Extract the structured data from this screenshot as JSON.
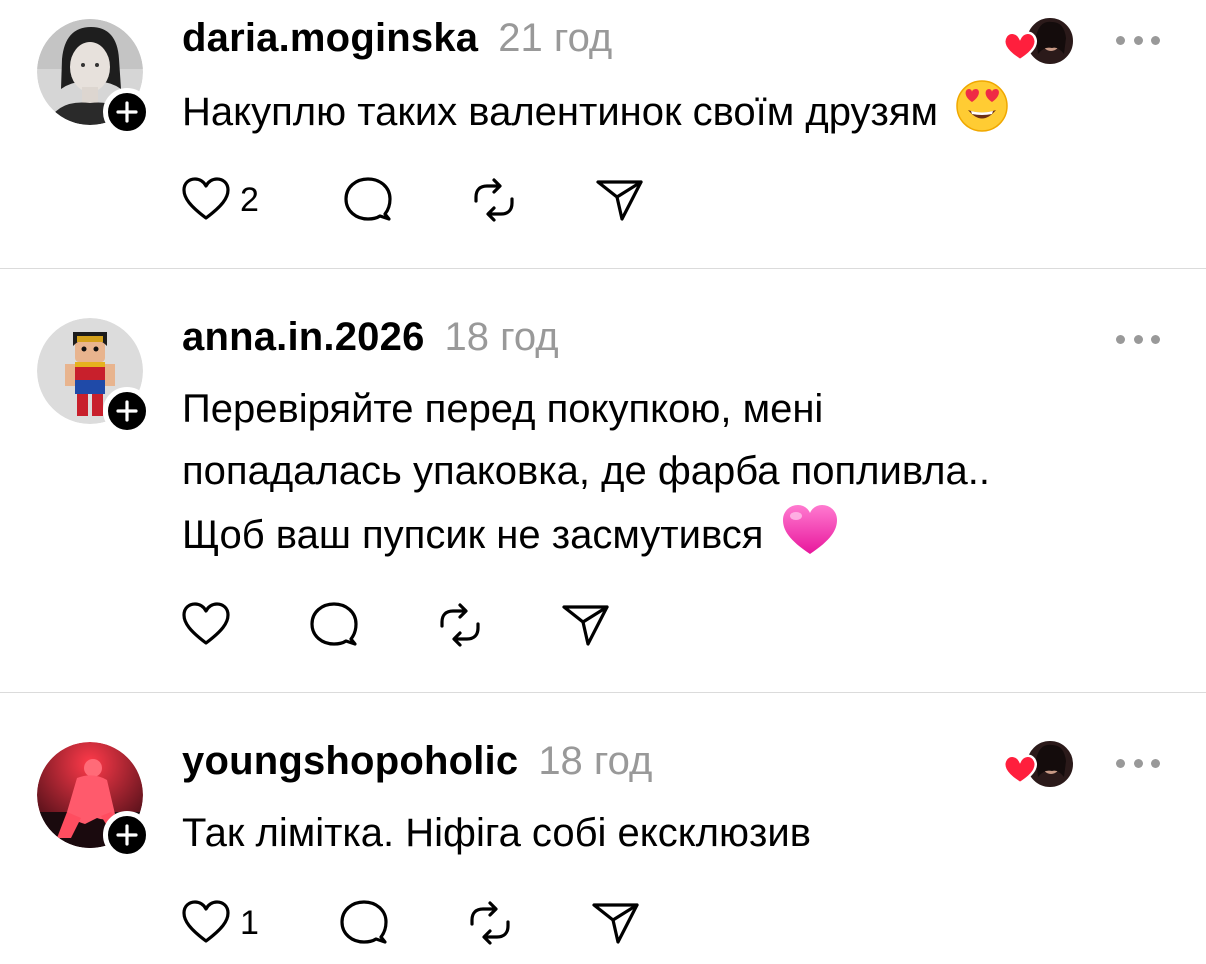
{
  "posts": [
    {
      "username": "daria.moginska",
      "time": "21 год",
      "lines": [
        "Накуплю таких валентинок своїм друзям"
      ],
      "line_emoji": "heart-eyes-emoji",
      "like_count": "2",
      "has_liker_badge": true
    },
    {
      "username": "anna.in.2026",
      "time": "18 год",
      "lines": [
        "Перевіряйте перед покупкою, мені",
        "попадалась упаковка, де фарба попливла..",
        "Щоб ваш пупсик не засмутився"
      ],
      "line_emoji": "pink-heart-emoji",
      "like_count": "",
      "has_liker_badge": false
    },
    {
      "username": "youngshopoholic",
      "time": "18 год",
      "lines": [
        "Так лімітка. Ніфіга собі ексклюзив"
      ],
      "line_emoji": "",
      "like_count": "1",
      "has_liker_badge": true
    }
  ],
  "icons": {
    "like": "heart-outline-icon",
    "reply": "speech-bubble-icon",
    "repost": "repost-icon",
    "share": "send-icon",
    "more": "more-dots-icon",
    "follow": "plus-icon"
  },
  "colors": {
    "text": "#000000",
    "muted": "#999999",
    "divider": "#dbdbdb",
    "liked_heart": "#ff1f3d"
  }
}
